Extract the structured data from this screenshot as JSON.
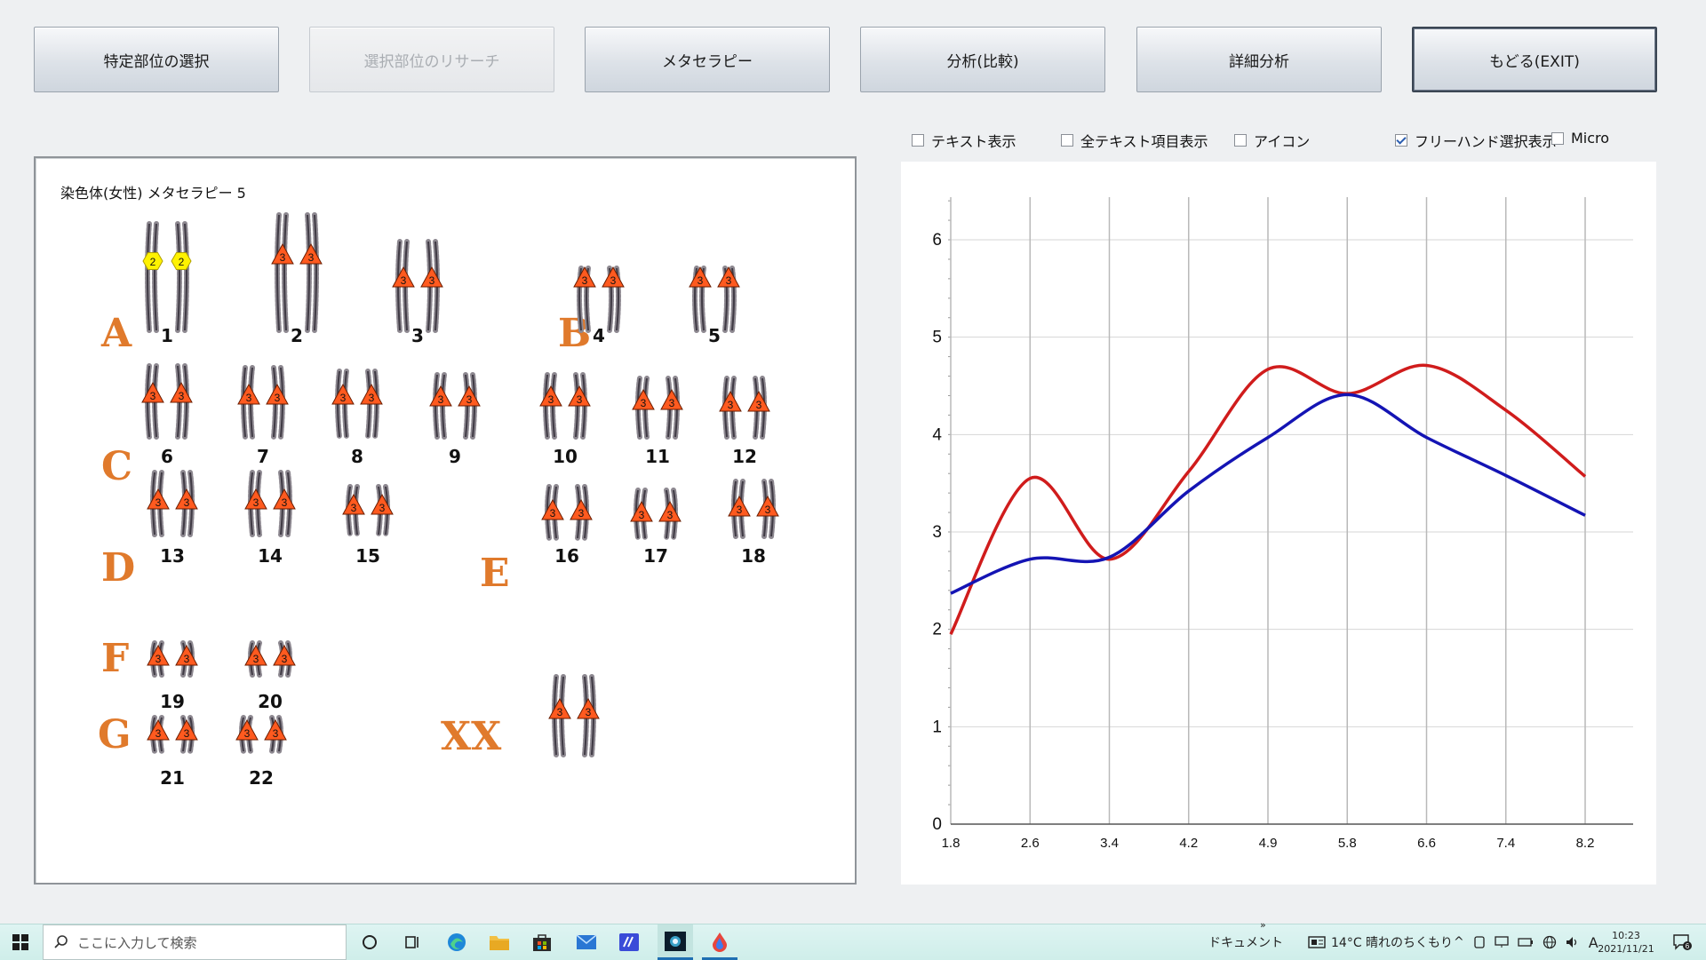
{
  "toolbar": {
    "select_region": "特定部位の選択",
    "research_region": "選択部位のリサーチ",
    "metatherapy": "メタセラピー",
    "analysis_compare": "分析(比較)",
    "detailed_analysis": "詳細分析",
    "back_exit": "もどる(EXIT)"
  },
  "options": {
    "text_display": "テキスト表示",
    "all_text_items": "全テキスト項目表示",
    "icon": "アイコン",
    "freehand_display": "フリーハンド選択表示",
    "micro": "Micro",
    "freehand_checked": true
  },
  "karyotype": {
    "title": "染色体(女性) メタセラピー 5",
    "groups": {
      "A": "A",
      "B": "B",
      "C": "C",
      "D": "D",
      "E": "E",
      "F": "F",
      "G": "G",
      "XX": "XX"
    },
    "chromosomes": [
      {
        "label": "1",
        "marker": "2",
        "shape": "hexagon"
      },
      {
        "label": "2",
        "marker": "3",
        "shape": "triangle"
      },
      {
        "label": "3",
        "marker": "3",
        "shape": "triangle"
      },
      {
        "label": "4",
        "marker": "3",
        "shape": "triangle"
      },
      {
        "label": "5",
        "marker": "3",
        "shape": "triangle"
      },
      {
        "label": "6",
        "marker": "3",
        "shape": "triangle"
      },
      {
        "label": "7",
        "marker": "3",
        "shape": "triangle"
      },
      {
        "label": "8",
        "marker": "3",
        "shape": "triangle"
      },
      {
        "label": "9",
        "marker": "3",
        "shape": "triangle"
      },
      {
        "label": "10",
        "marker": "3",
        "shape": "triangle"
      },
      {
        "label": "11",
        "marker": "3",
        "shape": "triangle"
      },
      {
        "label": "12",
        "marker": "3",
        "shape": "triangle"
      },
      {
        "label": "13",
        "marker": "3",
        "shape": "triangle"
      },
      {
        "label": "14",
        "marker": "3",
        "shape": "triangle"
      },
      {
        "label": "15",
        "marker": "3",
        "shape": "triangle"
      },
      {
        "label": "16",
        "marker": "3",
        "shape": "triangle"
      },
      {
        "label": "17",
        "marker": "3",
        "shape": "triangle"
      },
      {
        "label": "18",
        "marker": "3",
        "shape": "triangle"
      },
      {
        "label": "19",
        "marker": "3",
        "shape": "triangle"
      },
      {
        "label": "20",
        "marker": "3",
        "shape": "triangle"
      },
      {
        "label": "21",
        "marker": "3",
        "shape": "triangle"
      },
      {
        "label": "22",
        "marker": "3",
        "shape": "triangle"
      },
      {
        "label": "",
        "marker": "3",
        "shape": "triangle"
      }
    ]
  },
  "chart_data": {
    "type": "line",
    "x": [
      1.8,
      2.6,
      3.4,
      4.2,
      4.9,
      5.8,
      6.6,
      7.4,
      8.2
    ],
    "ylim": [
      0,
      6.5
    ],
    "yticks": [
      0,
      1,
      2,
      3,
      4,
      5,
      6
    ],
    "grid": true,
    "series": [
      {
        "color": "#d01c1c",
        "values": [
          1.95,
          3.55,
          2.72,
          3.62,
          4.67,
          4.42,
          4.71,
          4.25,
          3.57
        ]
      },
      {
        "color": "#1414b4",
        "values": [
          2.37,
          2.72,
          2.74,
          3.42,
          3.97,
          4.41,
          3.97,
          3.58,
          3.17
        ]
      }
    ]
  },
  "taskbar": {
    "search_placeholder": "ここに入力して検索",
    "documents": "ドキュメント",
    "weather": "14°C  晴れのちくもり",
    "ime": "A",
    "time": "10:23",
    "date": "2021/11/21",
    "notifications": "6"
  }
}
